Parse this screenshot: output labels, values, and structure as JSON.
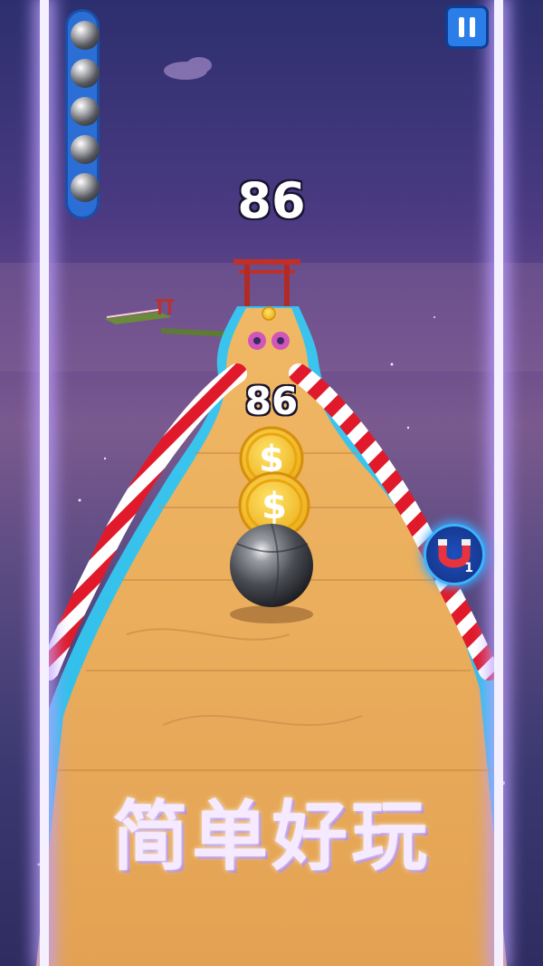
{
  "game": {
    "score_top": "86",
    "score_track": "86",
    "lives": 5,
    "magnet_count": "1",
    "tagline": "简单好玩"
  },
  "icons": {
    "pause": "pause-icon",
    "magnet": "magnet-icon",
    "coin": "dollar-coin-icon",
    "life": "steel-ball-icon",
    "gate": "torii-gate-icon"
  },
  "colors": {
    "sky_top": "#2c2f6e",
    "sky_mid": "#7a5a8e",
    "track_wood": "#e8a85a",
    "track_edge": "#25d4ff",
    "rail_red": "#e01a2a",
    "rail_white": "#ffffff",
    "coin_gold": "#f5c52a",
    "hud_blue": "#2b7de8"
  }
}
